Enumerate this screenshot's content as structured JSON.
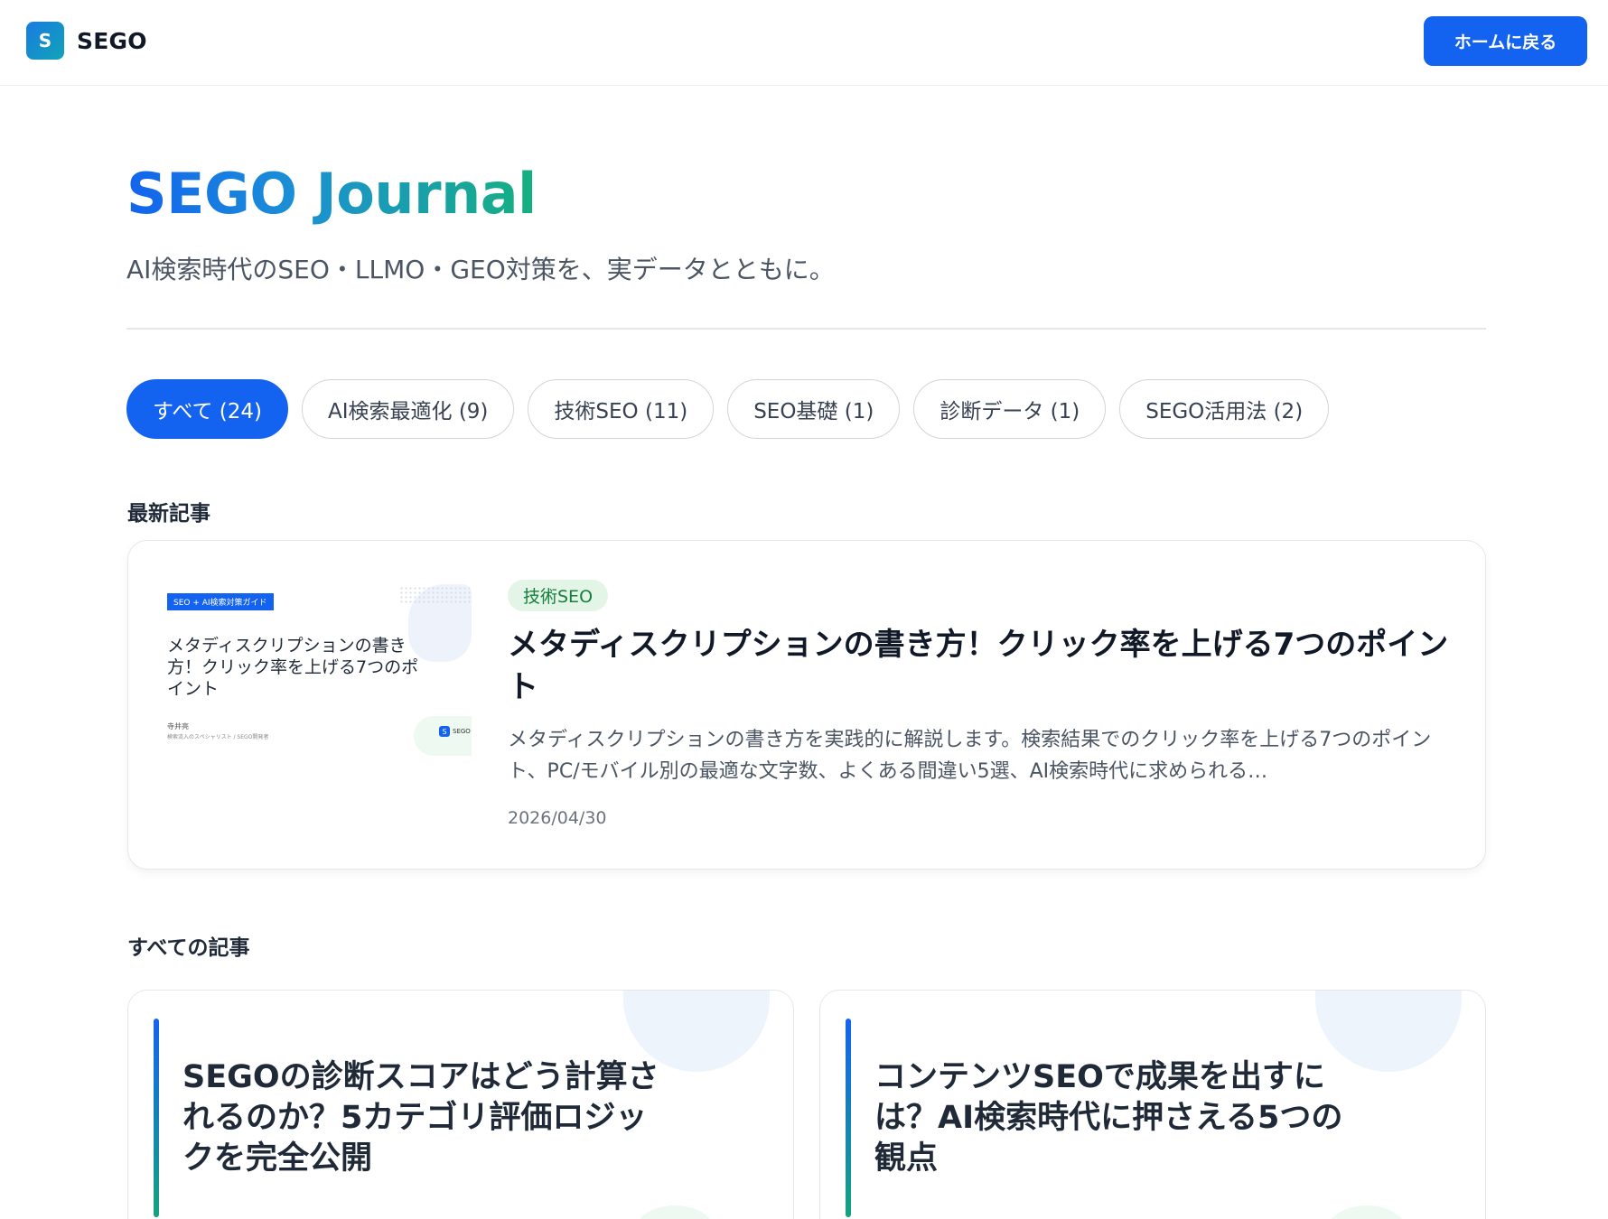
{
  "header": {
    "logo_mark": "S",
    "logo_text": "SEGO",
    "home_button": "ホームに戻る"
  },
  "hero": {
    "title": "SEGO Journal",
    "subtitle": "AI検索時代のSEO・LLMO・GEO対策を、実データとともに。"
  },
  "filters": [
    {
      "label": "すべて (24)",
      "active": true
    },
    {
      "label": "AI検索最適化 (9)",
      "active": false
    },
    {
      "label": "技術SEO (11)",
      "active": false
    },
    {
      "label": "SEO基礎 (1)",
      "active": false
    },
    {
      "label": "診断データ (1)",
      "active": false
    },
    {
      "label": "SEGO活用法 (2)",
      "active": false
    }
  ],
  "sections": {
    "latest": "最新記事",
    "all": "すべての記事"
  },
  "featured": {
    "thumbnail": {
      "tag": "SEO + AI検索対策ガイド",
      "title": "メタディスクリプションの書き方！クリック率を上げる7つのポイント",
      "author": "寺井亮",
      "author_desc": "検索流入のスペシャリスト / SEGO開発者",
      "logo_mark": "S",
      "logo_text": "SEGO"
    },
    "category": "技術SEO",
    "title": "メタディスクリプションの書き方！クリック率を上げる7つのポイント",
    "excerpt": "メタディスクリプションの書き方を実践的に解説します。検索結果でのクリック率を上げる7つのポイント、PC/モバイル別の最適な文字数、よくある間違い5選、AI検索時代に求められる…",
    "date": "2026/04/30"
  },
  "articles": [
    {
      "title": "SEGOの診断スコアはどう計算されるのか？5カテゴリ評価ロジックを完全公開"
    },
    {
      "title": "コンテンツSEOで成果を出すには？AI検索時代に押さえる5つの観点"
    }
  ],
  "colors": {
    "primary": "#1463f0",
    "accent_green": "#16b07f",
    "badge_bg": "#e3f5e7",
    "badge_text": "#15803d"
  }
}
